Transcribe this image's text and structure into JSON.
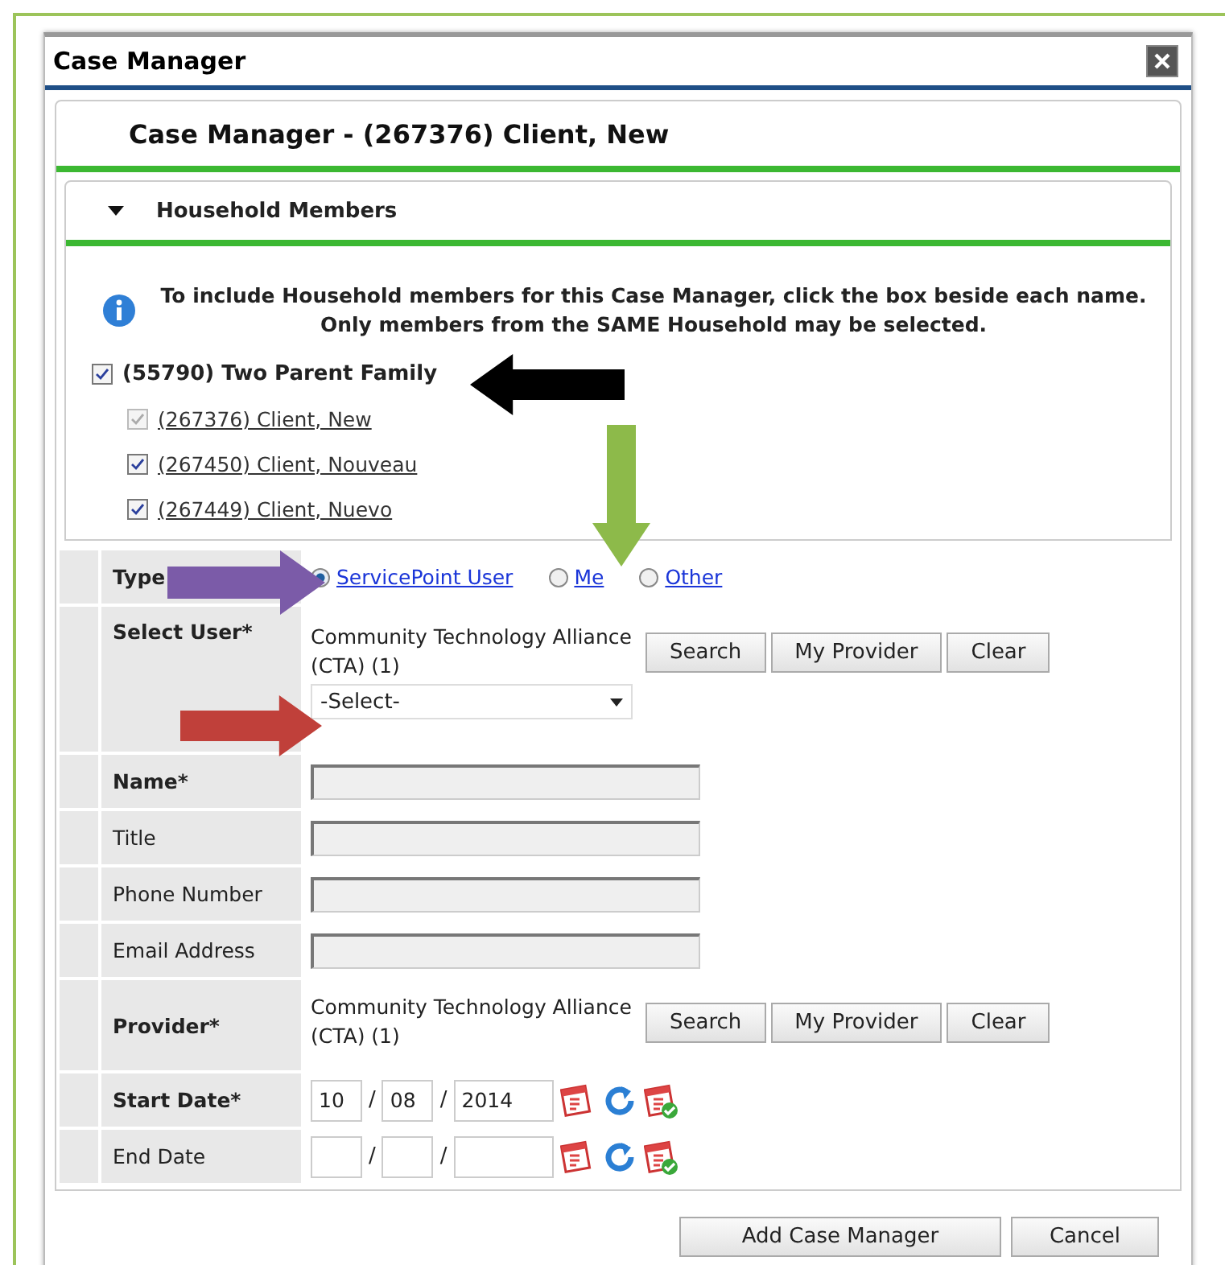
{
  "window": {
    "title": "Case Manager"
  },
  "header": {
    "title": "Case Manager - (267376) Client, New"
  },
  "household": {
    "title": "Household Members",
    "expanded": true,
    "info": "To include Household members for this Case Manager, click the box beside each name. Only members from the SAME Household may be selected.",
    "family": {
      "label": "(55790) Two Parent Family",
      "checked": true
    },
    "members": [
      {
        "label": "(267376) Client, New",
        "checked": true,
        "disabled": true
      },
      {
        "label": "(267450) Client, Nouveau",
        "checked": true,
        "disabled": false
      },
      {
        "label": "(267449) Client, Nuevo",
        "checked": true,
        "disabled": false
      }
    ]
  },
  "form": {
    "rows": [
      {
        "kind": "radio",
        "label": "Type",
        "required": true,
        "options": [
          {
            "label": "ServicePoint User",
            "selected": true
          },
          {
            "label": "Me",
            "selected": false
          },
          {
            "label": "Other",
            "selected": false
          }
        ]
      },
      {
        "kind": "picker",
        "label": "Select User*",
        "required": true,
        "provider": "Community Technology Alliance (CTA) (1)",
        "buttons": [
          "Search",
          "My Provider",
          "Clear"
        ],
        "select": "-Select-"
      },
      {
        "kind": "text",
        "label": "Name*",
        "required": true
      },
      {
        "kind": "text",
        "label": "Title",
        "required": false
      },
      {
        "kind": "text",
        "label": "Phone Number",
        "required": false
      },
      {
        "kind": "text",
        "label": "Email Address",
        "required": false
      },
      {
        "kind": "picker",
        "label": "Provider*",
        "required": true,
        "provider": "Community Technology Alliance (CTA) (1)",
        "buttons": [
          "Search",
          "My Provider",
          "Clear"
        ]
      },
      {
        "kind": "date",
        "label": "Start Date*",
        "required": true,
        "month": "10",
        "day": "08",
        "year": "2014",
        "separators": [
          "/",
          "/"
        ]
      },
      {
        "kind": "date",
        "label": "End Date",
        "required": false,
        "separators": [
          "/",
          "/"
        ]
      }
    ]
  },
  "buttons": [
    "Add Case Manager",
    "Cancel"
  ],
  "annotations": [
    {
      "kind": "arrow",
      "color": "#000000"
    },
    {
      "kind": "arrow",
      "color": "#8dba4a"
    },
    {
      "kind": "arrow",
      "color": "#7b5ba8"
    },
    {
      "kind": "arrow",
      "color": "#c0403a"
    }
  ]
}
